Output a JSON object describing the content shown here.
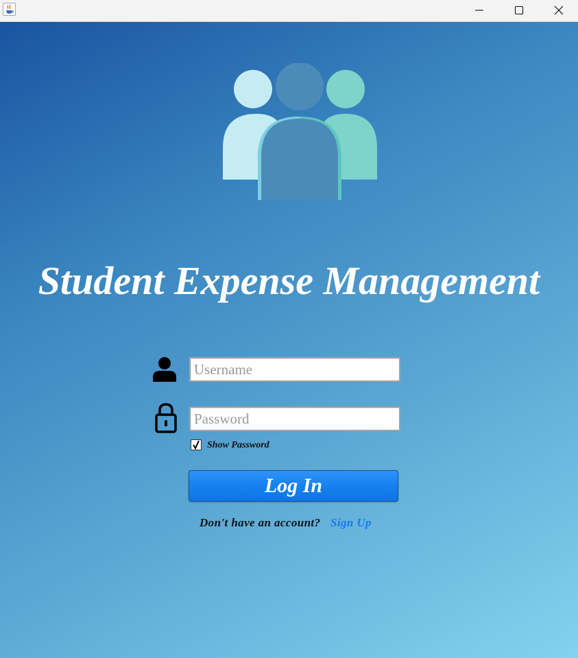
{
  "titlebar": {
    "app_icon": "java-cup-icon",
    "controls": [
      "minimize-icon",
      "maximize-icon",
      "close-icon"
    ]
  },
  "logo": {
    "icon": "users-group-icon",
    "colors": {
      "left_person": "#c5ecf3",
      "right_person": "#7ed3ca",
      "center_person": "#4c8bb8",
      "outline_left": "#7bd1e0",
      "outline_right": "#5cc6bf"
    }
  },
  "title": "Student Expense Management",
  "login": {
    "username_icon": "user-icon",
    "password_icon": "lock-icon",
    "username_placeholder": "Username",
    "username_value": "",
    "password_placeholder": "Password",
    "password_value": "",
    "show_password_label": "Show Password",
    "show_password_checked": true,
    "login_button": "Log In",
    "no_account_text": "Don't have an account?",
    "signup_link": "Sign Up"
  },
  "colors": {
    "gradient_start": "#1a54a1",
    "gradient_end": "#82d3ee",
    "button": "#1783f0",
    "link": "#1778f2",
    "title_text": "#ffffff"
  }
}
